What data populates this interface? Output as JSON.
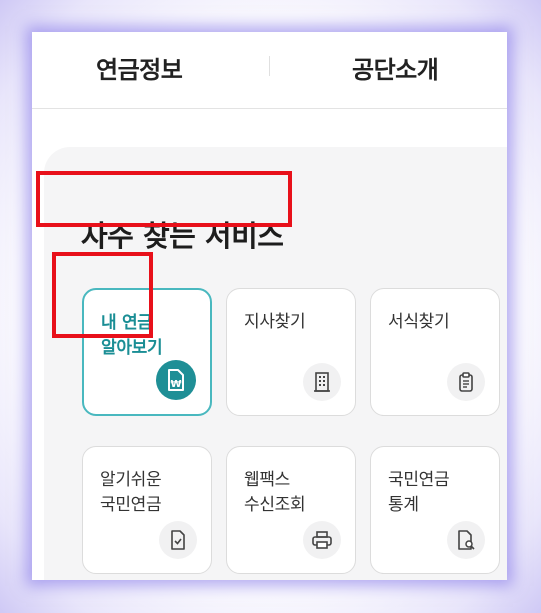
{
  "nav": {
    "items": [
      {
        "label": "연금정보"
      },
      {
        "label": "공단소개"
      }
    ]
  },
  "services": {
    "title": "자주 찾는 서비스",
    "cards": [
      {
        "label": "내 연금\n알아보기",
        "icon": "won-document-icon",
        "active": true
      },
      {
        "label": "지사찾기",
        "icon": "building-icon",
        "active": false
      },
      {
        "label": "서식찾기",
        "icon": "clipboard-icon",
        "active": false
      },
      {
        "label": "알기쉬운\n국민연금",
        "icon": "document-check-icon",
        "active": false
      },
      {
        "label": "웹팩스\n수신조회",
        "icon": "printer-icon",
        "active": false
      },
      {
        "label": "국민연금\n통계",
        "icon": "document-search-icon",
        "active": false
      }
    ]
  },
  "colors": {
    "accent": "#1f8f96",
    "highlight_border": "#e8101a",
    "active_card_border": "#49b8bf"
  }
}
